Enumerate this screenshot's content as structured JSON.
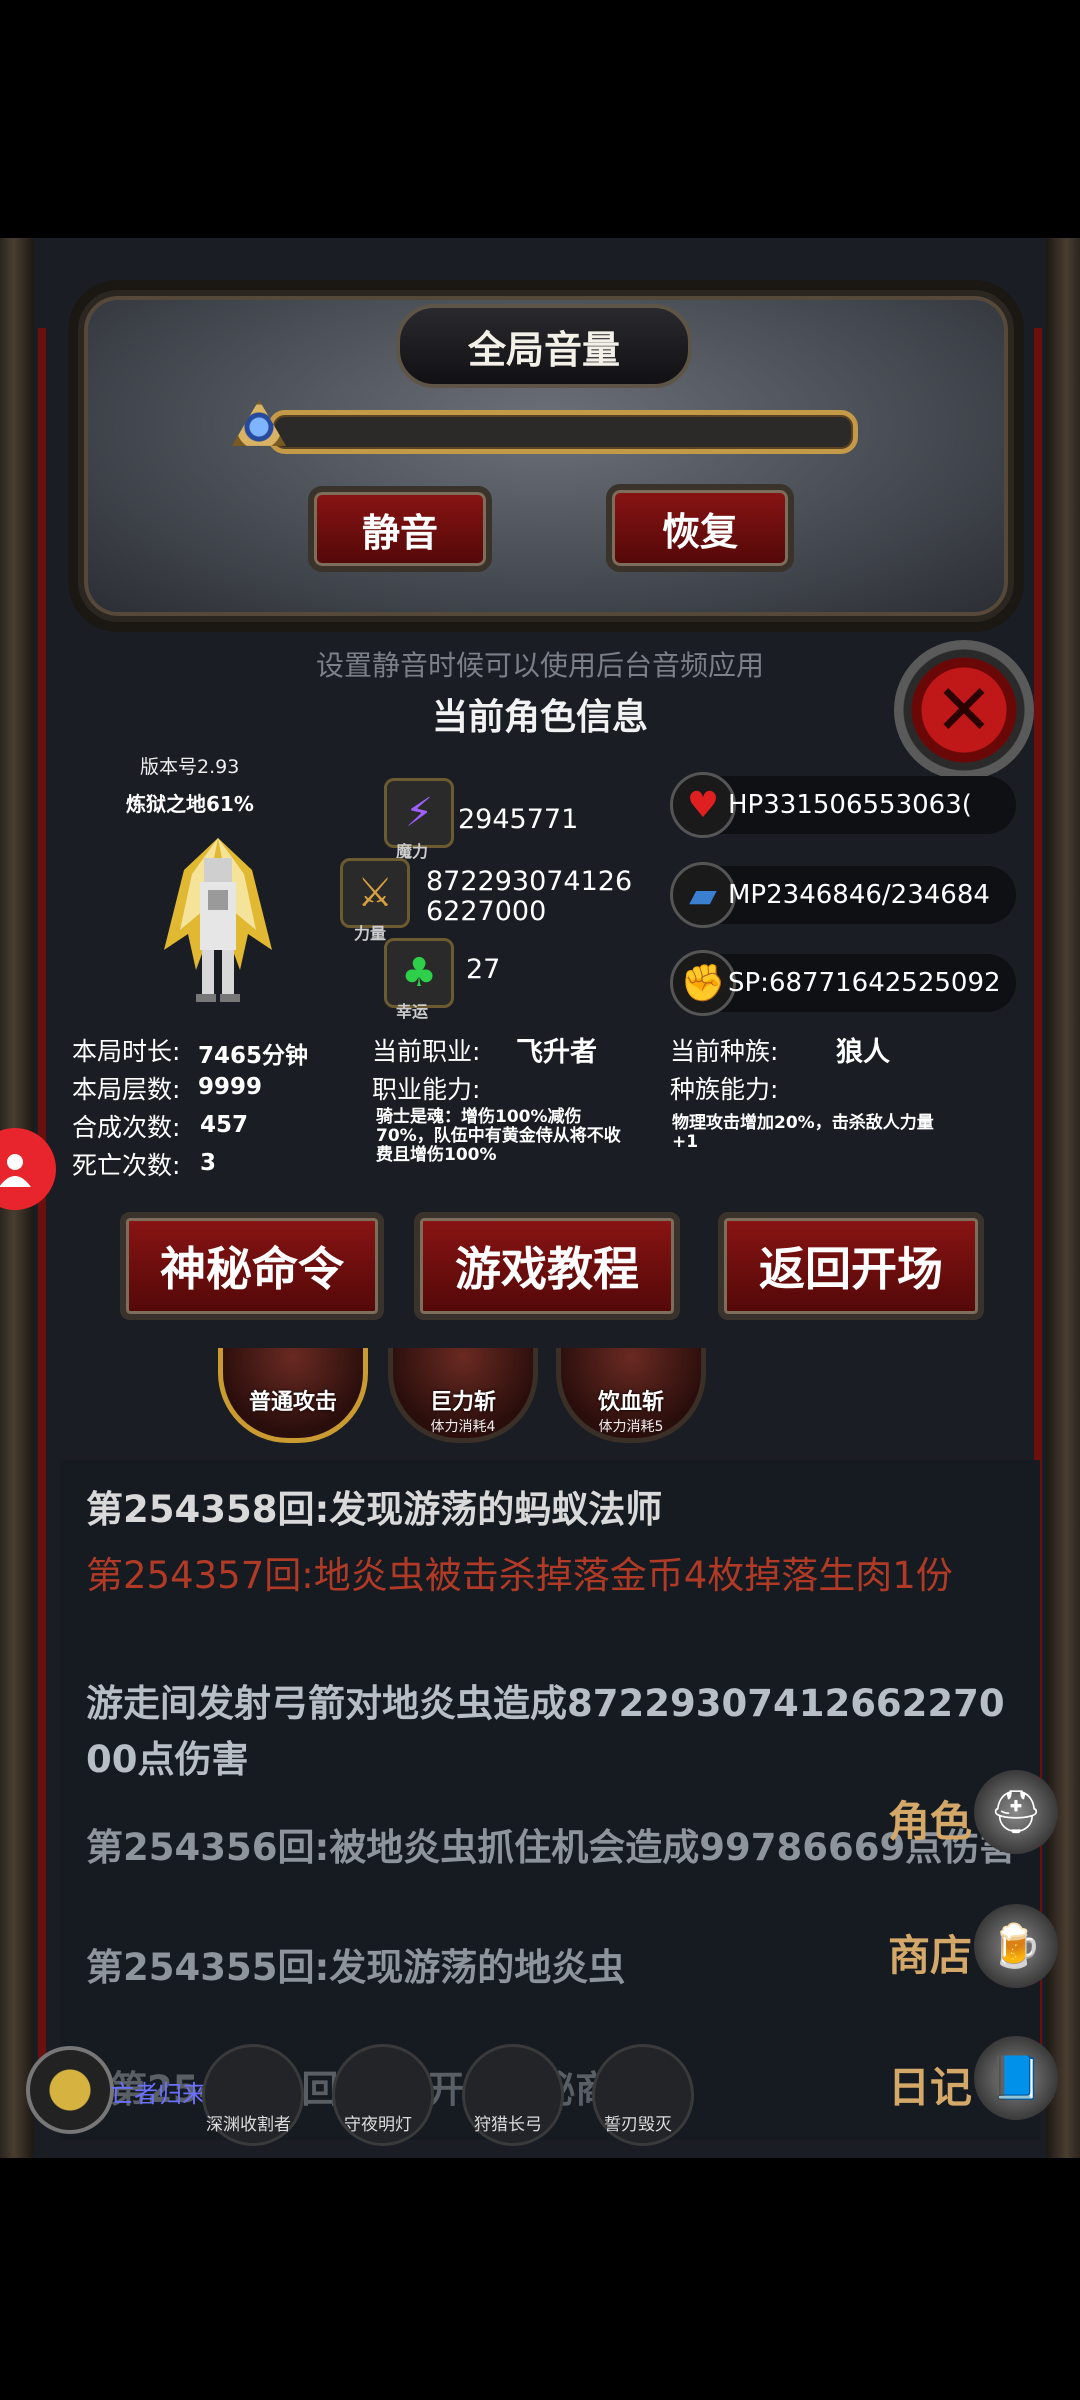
{
  "volume": {
    "title": "全局音量",
    "mute_label": "静音",
    "restore_label": "恢复",
    "hint": "设置静音时候可以使用后台音频应用"
  },
  "character": {
    "title": "当前角色信息",
    "version": "版本号2.93",
    "hell_progress": "炼狱之地61%",
    "magic_value": "2945771",
    "magic_caption": "魔力",
    "strength_value_line1": "872293074126",
    "strength_value_line2": "6227000",
    "strength_caption": "力量",
    "luck_value": "27",
    "luck_caption": "幸运",
    "hp": "HP331506553063(",
    "mp": "MP2346846/234684",
    "sp": "SP:68771642525092",
    "play_time_label": "本局时长:",
    "play_time_value": "7465分钟",
    "floors_label": "本局层数:",
    "floors_value": "9999",
    "craft_label": "合成次数:",
    "craft_value": "457",
    "deaths_label": "死亡次数:",
    "deaths_value": "3",
    "job_label": "当前职业:",
    "job_value": "飞升者",
    "job_ability_label": "职业能力:",
    "job_ability_text": "骑士是魂：增伤100%减伤70%，队伍中有黄金侍从将不收费且增伤100%",
    "race_label": "当前种族:",
    "race_value": "狼人",
    "race_ability_label": "种族能力:",
    "race_ability_text": "物理攻击增加20%，击杀敌人力量+1"
  },
  "actions": {
    "mystery_label": "神秘命令",
    "tutorial_label": "游戏教程",
    "return_label": "返回开场"
  },
  "skills": [
    {
      "name": "普通攻击",
      "cost": ""
    },
    {
      "name": "巨力斩",
      "cost": "体力消耗4"
    },
    {
      "name": "饮血斩",
      "cost": "体力消耗5"
    }
  ],
  "log": [
    "第254358回:发现游荡的蚂蚁法师",
    "第254357回:地炎虫被击杀掉落金币4枚掉落生肉1份",
    "游走间发射弓箭对地炎虫造成8722930741266227000点伤害",
    "第254356回:被地炎虫抓住机会造成99786669点伤害",
    "第254355回:发现游荡的地炎虫",
    "第254354回:你离开啦神秘商店"
  ],
  "side": {
    "role": "角色",
    "shop": "商店",
    "diary": "日记"
  },
  "bottom": {
    "undead": "亡者归来",
    "items": [
      "深渊收割者",
      "守夜明灯",
      "狩猎长弓",
      "誓刃毁灭"
    ]
  },
  "icons": {
    "magic": "lightning-icon",
    "strength": "sword-icon",
    "luck": "clover-icon",
    "hp": "heart-icon",
    "mp": "boot-icon",
    "sp": "strength-icon",
    "close": "close-icon",
    "user": "user-icon"
  },
  "colors": {
    "button_red": "#8a1414",
    "gold": "#c49a48",
    "log_red": "#b03a26",
    "side_text": "#d4a868",
    "undead_text": "#6a70ff"
  }
}
